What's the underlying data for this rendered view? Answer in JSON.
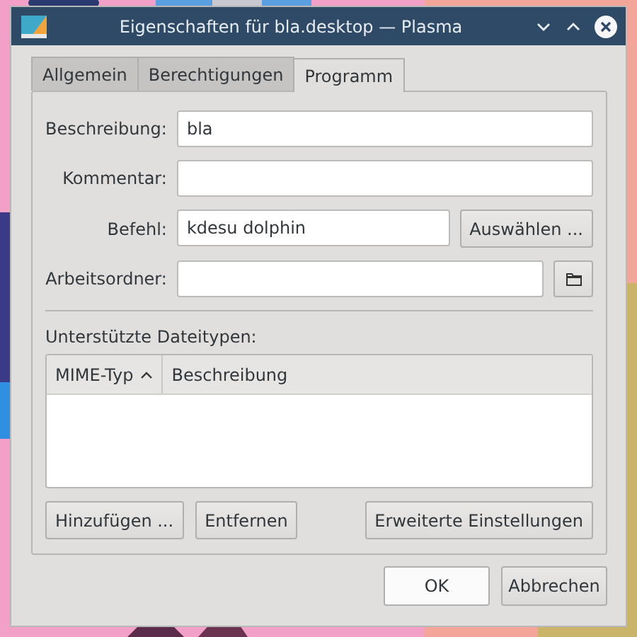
{
  "window": {
    "title": "Eigenschaften für bla.desktop — Plasma"
  },
  "tabs": [
    {
      "label": "Allgemein",
      "selected": false
    },
    {
      "label": "Berechtigungen",
      "selected": false
    },
    {
      "label": "Programm",
      "selected": true
    }
  ],
  "fields": [
    {
      "label": "Beschreibung:",
      "value": "bla",
      "kind": "plain"
    },
    {
      "label": "Kommentar:",
      "kind": "plain"
    },
    {
      "label": "Befehl:",
      "value": "kdesu dolphin",
      "kind": "button",
      "button": "Auswählen ..."
    },
    {
      "label": "Arbeitsordner:",
      "kind": "folder"
    }
  ],
  "section_label": "Unterstützte Dateitypen:",
  "table": {
    "columns": [
      {
        "label": "MIME-Typ",
        "sorted": true
      },
      {
        "label": "Beschreibung",
        "sorted": false
      }
    ]
  },
  "table_buttons": [
    {
      "label": "Hinzufügen ..."
    },
    {
      "label": "Entfernen"
    },
    {
      "label": "Erweiterte Einstellungen"
    }
  ],
  "dialog_buttons": [
    {
      "label": "OK",
      "default": true
    },
    {
      "label": "Abbrechen",
      "default": false
    }
  ]
}
